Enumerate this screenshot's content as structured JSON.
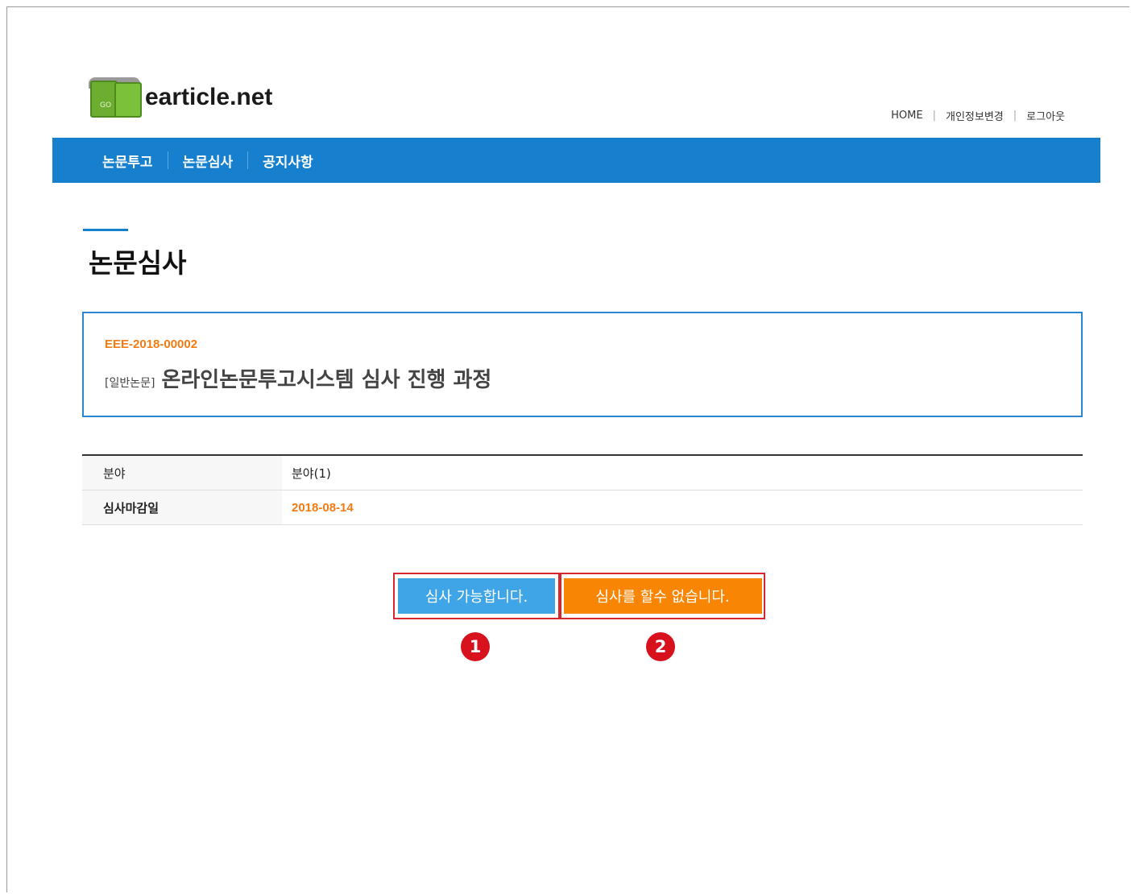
{
  "header": {
    "logo_text": "earticle.net",
    "logo_book_text": "GO",
    "links": [
      "HOME",
      "개인정보변경",
      "로그아웃"
    ],
    "separator": "|"
  },
  "nav": {
    "items": [
      "논문투고",
      "논문심사",
      "공지사항"
    ]
  },
  "page": {
    "title": "논문심사"
  },
  "paper": {
    "id": "EEE-2018-00002",
    "type": "[일반논문]",
    "title": "온라인논문투고시스템 심사 진행 과정"
  },
  "info": {
    "rows": [
      {
        "label": "분야",
        "value": "분야(1)"
      },
      {
        "label": "심사마감일",
        "value": "2018-08-14"
      }
    ]
  },
  "actions": {
    "accept_label": "심사 가능합니다.",
    "decline_label": "심사를 할수 없습니다.",
    "badge_1": "1",
    "badge_2": "2"
  },
  "colors": {
    "nav_bg": "#1680cf",
    "accent_orange": "#f47a12",
    "button_blue": "#3fa5e7",
    "button_orange": "#f98505",
    "annotation_red": "#d8121c"
  }
}
